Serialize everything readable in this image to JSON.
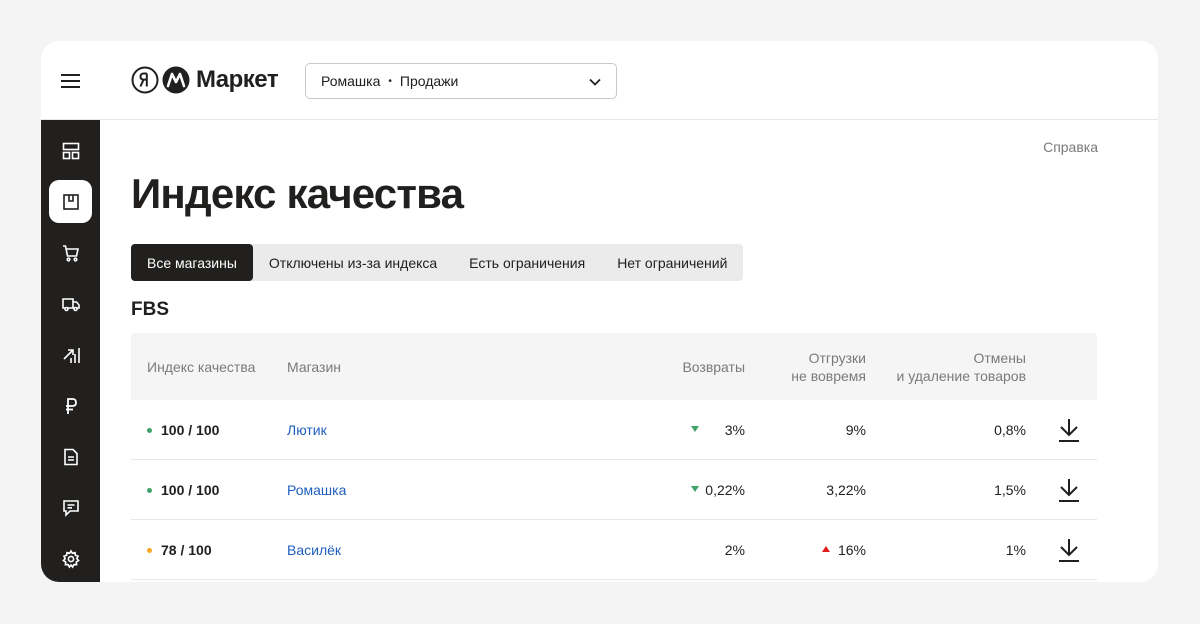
{
  "header": {
    "logo_text": "Маркет",
    "store_name": "Ромашка",
    "store_sep": "•",
    "store_section": "Продажи"
  },
  "help_label": "Справка",
  "page_title": "Индекс качества",
  "tabs": [
    {
      "label": "Все магазины",
      "active": true
    },
    {
      "label": "Отключены из-за индекса",
      "active": false
    },
    {
      "label": "Есть ограничения",
      "active": false
    },
    {
      "label": "Нет ограничений",
      "active": false
    }
  ],
  "section_title": "FBS",
  "table": {
    "columns": {
      "index": "Индекс качества",
      "store": "Магазин",
      "returns": "Возвраты",
      "late_1": "Отгрузки",
      "late_2": "не вовремя",
      "cancel_1": "Отмены",
      "cancel_2": "и удаление товаров"
    },
    "rows": [
      {
        "score": "100 / 100",
        "status": "good",
        "store": "Лютик",
        "returns": "3%",
        "returns_trend": "down",
        "late": "9%",
        "late_trend": "",
        "cancel": "0,8%"
      },
      {
        "score": "100 / 100",
        "status": "good",
        "store": "Ромашка",
        "returns": "0,22%",
        "returns_trend": "down",
        "late": "3,22%",
        "late_trend": "",
        "cancel": "1,5%"
      },
      {
        "score": "78 / 100",
        "status": "warn",
        "store": "Василёк",
        "returns": "2%",
        "returns_trend": "",
        "late": "16%",
        "late_trend": "up",
        "cancel": "1%"
      }
    ]
  },
  "colors": {
    "good": "#3fa36a",
    "warn": "#f5a623",
    "link": "#1f5fbf",
    "dark": "#21201f"
  },
  "sidebar_icons": [
    "dashboard-icon",
    "box-icon",
    "cart-icon",
    "truck-icon",
    "growth-chart-icon",
    "ruble-icon",
    "document-icon",
    "chat-icon",
    "gear-icon"
  ]
}
